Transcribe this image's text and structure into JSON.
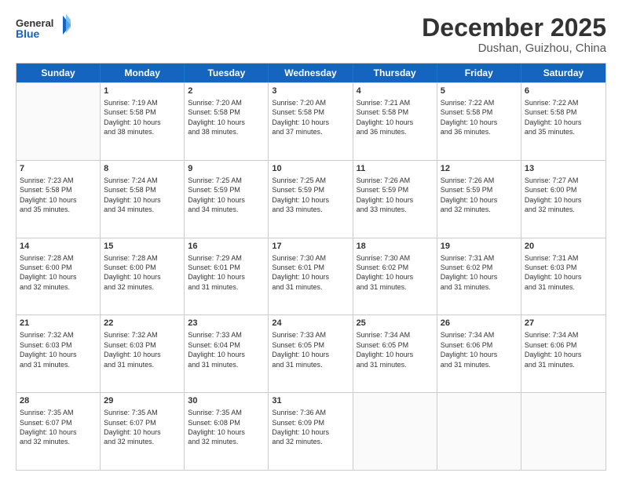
{
  "header": {
    "logo_general": "General",
    "logo_blue": "Blue",
    "month_title": "December 2025",
    "location": "Dushan, Guizhou, China"
  },
  "weekdays": [
    "Sunday",
    "Monday",
    "Tuesday",
    "Wednesday",
    "Thursday",
    "Friday",
    "Saturday"
  ],
  "rows": [
    [
      {
        "day": "",
        "content": ""
      },
      {
        "day": "1",
        "content": "Sunrise: 7:19 AM\nSunset: 5:58 PM\nDaylight: 10 hours\nand 38 minutes."
      },
      {
        "day": "2",
        "content": "Sunrise: 7:20 AM\nSunset: 5:58 PM\nDaylight: 10 hours\nand 38 minutes."
      },
      {
        "day": "3",
        "content": "Sunrise: 7:20 AM\nSunset: 5:58 PM\nDaylight: 10 hours\nand 37 minutes."
      },
      {
        "day": "4",
        "content": "Sunrise: 7:21 AM\nSunset: 5:58 PM\nDaylight: 10 hours\nand 36 minutes."
      },
      {
        "day": "5",
        "content": "Sunrise: 7:22 AM\nSunset: 5:58 PM\nDaylight: 10 hours\nand 36 minutes."
      },
      {
        "day": "6",
        "content": "Sunrise: 7:22 AM\nSunset: 5:58 PM\nDaylight: 10 hours\nand 35 minutes."
      }
    ],
    [
      {
        "day": "7",
        "content": "Sunrise: 7:23 AM\nSunset: 5:58 PM\nDaylight: 10 hours\nand 35 minutes."
      },
      {
        "day": "8",
        "content": "Sunrise: 7:24 AM\nSunset: 5:58 PM\nDaylight: 10 hours\nand 34 minutes."
      },
      {
        "day": "9",
        "content": "Sunrise: 7:25 AM\nSunset: 5:59 PM\nDaylight: 10 hours\nand 34 minutes."
      },
      {
        "day": "10",
        "content": "Sunrise: 7:25 AM\nSunset: 5:59 PM\nDaylight: 10 hours\nand 33 minutes."
      },
      {
        "day": "11",
        "content": "Sunrise: 7:26 AM\nSunset: 5:59 PM\nDaylight: 10 hours\nand 33 minutes."
      },
      {
        "day": "12",
        "content": "Sunrise: 7:26 AM\nSunset: 5:59 PM\nDaylight: 10 hours\nand 32 minutes."
      },
      {
        "day": "13",
        "content": "Sunrise: 7:27 AM\nSunset: 6:00 PM\nDaylight: 10 hours\nand 32 minutes."
      }
    ],
    [
      {
        "day": "14",
        "content": "Sunrise: 7:28 AM\nSunset: 6:00 PM\nDaylight: 10 hours\nand 32 minutes."
      },
      {
        "day": "15",
        "content": "Sunrise: 7:28 AM\nSunset: 6:00 PM\nDaylight: 10 hours\nand 32 minutes."
      },
      {
        "day": "16",
        "content": "Sunrise: 7:29 AM\nSunset: 6:01 PM\nDaylight: 10 hours\nand 31 minutes."
      },
      {
        "day": "17",
        "content": "Sunrise: 7:30 AM\nSunset: 6:01 PM\nDaylight: 10 hours\nand 31 minutes."
      },
      {
        "day": "18",
        "content": "Sunrise: 7:30 AM\nSunset: 6:02 PM\nDaylight: 10 hours\nand 31 minutes."
      },
      {
        "day": "19",
        "content": "Sunrise: 7:31 AM\nSunset: 6:02 PM\nDaylight: 10 hours\nand 31 minutes."
      },
      {
        "day": "20",
        "content": "Sunrise: 7:31 AM\nSunset: 6:03 PM\nDaylight: 10 hours\nand 31 minutes."
      }
    ],
    [
      {
        "day": "21",
        "content": "Sunrise: 7:32 AM\nSunset: 6:03 PM\nDaylight: 10 hours\nand 31 minutes."
      },
      {
        "day": "22",
        "content": "Sunrise: 7:32 AM\nSunset: 6:03 PM\nDaylight: 10 hours\nand 31 minutes."
      },
      {
        "day": "23",
        "content": "Sunrise: 7:33 AM\nSunset: 6:04 PM\nDaylight: 10 hours\nand 31 minutes."
      },
      {
        "day": "24",
        "content": "Sunrise: 7:33 AM\nSunset: 6:05 PM\nDaylight: 10 hours\nand 31 minutes."
      },
      {
        "day": "25",
        "content": "Sunrise: 7:34 AM\nSunset: 6:05 PM\nDaylight: 10 hours\nand 31 minutes."
      },
      {
        "day": "26",
        "content": "Sunrise: 7:34 AM\nSunset: 6:06 PM\nDaylight: 10 hours\nand 31 minutes."
      },
      {
        "day": "27",
        "content": "Sunrise: 7:34 AM\nSunset: 6:06 PM\nDaylight: 10 hours\nand 31 minutes."
      }
    ],
    [
      {
        "day": "28",
        "content": "Sunrise: 7:35 AM\nSunset: 6:07 PM\nDaylight: 10 hours\nand 32 minutes."
      },
      {
        "day": "29",
        "content": "Sunrise: 7:35 AM\nSunset: 6:07 PM\nDaylight: 10 hours\nand 32 minutes."
      },
      {
        "day": "30",
        "content": "Sunrise: 7:35 AM\nSunset: 6:08 PM\nDaylight: 10 hours\nand 32 minutes."
      },
      {
        "day": "31",
        "content": "Sunrise: 7:36 AM\nSunset: 6:09 PM\nDaylight: 10 hours\nand 32 minutes."
      },
      {
        "day": "",
        "content": ""
      },
      {
        "day": "",
        "content": ""
      },
      {
        "day": "",
        "content": ""
      }
    ]
  ]
}
